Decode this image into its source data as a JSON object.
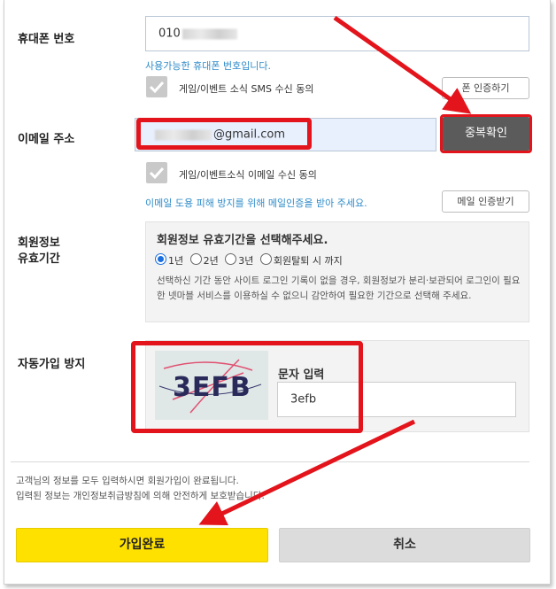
{
  "phone": {
    "label": "휴대폰 번호",
    "value_prefix": "010",
    "status": "사용가능한 휴대폰 번호입니다.",
    "sms_consent": "게임/이벤트 소식 SMS 수신 동의",
    "verify_button": "폰 인증하기"
  },
  "email": {
    "label": "이메일 주소",
    "value_suffix": "@gmail.com",
    "dup_check_button": "중복확인",
    "consent": "게임/이벤트소식 이메일 수신 동의",
    "notice": "이메일 도용 피해 방지를 위해 메일인증을 받아 주세요.",
    "verify_button": "메일 인증받기"
  },
  "validity": {
    "label_line1": "회원정보",
    "label_line2": "유효기간",
    "title": "회원정보 유효기간을 선택해주세요.",
    "options": [
      "1년",
      "2년",
      "3년",
      "회원탈퇴 시 까지"
    ],
    "selected": "1년",
    "description": "선택하신 기간 동안 사이트 로그인 기록이 없을 경우, 회원정보가 분리·보관되어 로그인이 필요한 넷마블 서비스를 이용하실 수 없으니 감안하여 필요한 기간으로 선택해 주세요."
  },
  "captcha": {
    "label": "자동가입 방지",
    "image_text": "3EFB",
    "input_label": "문자 입력",
    "input_value": "3efb"
  },
  "footer": {
    "line1": "고객님의 정보를 모두 입력하시면 회원가입이 완료됩니다.",
    "line2": "입력된 정보는 개인정보취급방침에 의해 안전하게 보호받습니다.",
    "submit_button": "가입완료",
    "cancel_button": "취소"
  },
  "colors": {
    "accent_yellow": "#ffe100",
    "annotation_red": "#e3141b",
    "link_blue": "#2e8bc9",
    "dark_button": "#5b5b5b"
  }
}
